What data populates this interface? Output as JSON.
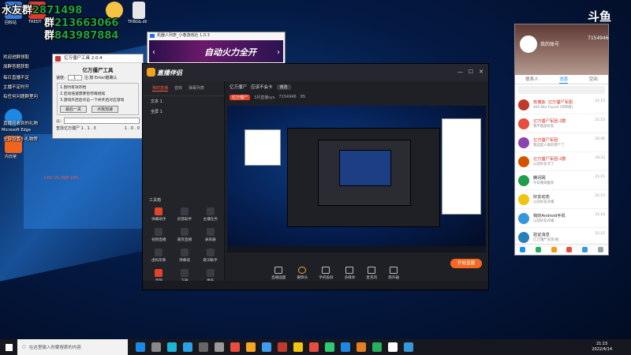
{
  "overlay": {
    "line1": "水友群",
    "line1_num": "2871498",
    "line2_prefix": "群",
    "line2_num": "213663066",
    "line3_prefix": "群",
    "line3_num": "843987884",
    "notes": [
      "欢迎进群领取",
      "加群答题获取",
      "每日直播不定",
      "主播不定时开",
      "有任何问题群里问",
      "直播间收到的礼物",
      "全部设置小礼物赞"
    ]
  },
  "desktop": {
    "icons": [
      {
        "label": "回收站",
        "color": "#3a7bd5"
      },
      {
        "label": "TREDT",
        "color": "#e23b2a"
      },
      {
        "label": "QQ",
        "color": "#f6c343"
      },
      {
        "label": "TRBGb.dll",
        "color": "#e6e6e6"
      },
      {
        "label": "Microsoft Edge",
        "color": "#1e88e5"
      },
      {
        "label": "内日常",
        "color": "#f0641e"
      }
    ],
    "cpu_text": "CPU 1%  内存 19%"
  },
  "tool_window": {
    "title": "亿万僵尸工具 2.0.4",
    "header": "亿万僵尸工具",
    "speed_label": "速度:",
    "speed_value": "1",
    "speed_hint": "注:按 Enter键确认",
    "steps": [
      "1.暂时有效存档",
      "2.启动倍速需要暂停再继续",
      "3.游戏开启后点击一下并开启对应游戏"
    ],
    "btn_prev": "最后一关",
    "btn_apply": "点我加速",
    "save_label": "以:",
    "footer_left": "查找亿万僵尸 1 . 1 . 3",
    "footer_right": "1 . 0 . 0"
  },
  "ad_window": {
    "title": "机器人列表_小巷游戏社 1.0.3",
    "banner_text": "自动火力全开"
  },
  "app": {
    "logo": "直播伴侣",
    "side_tabs": [
      "我的直播",
      "音效",
      "弹幕列表"
    ],
    "scenes": [
      "文本 1",
      "全屏 1"
    ],
    "tools_title": "工具箱",
    "tools": [
      {
        "label": "弹幕助手",
        "active": true
      },
      {
        "label": "房管助手",
        "active": false
      },
      {
        "label": "主播任务",
        "active": false
      },
      {
        "label": "视频直播",
        "active": false
      },
      {
        "label": "嘉宾直播",
        "active": false
      },
      {
        "label": "录屏器",
        "active": false
      },
      {
        "label": "虚拟形象",
        "active": false
      },
      {
        "label": "弹幕墙",
        "active": false
      },
      {
        "label": "歌词助手",
        "active": false
      },
      {
        "label": "音频",
        "active": false
      },
      {
        "label": "下载",
        "active": false
      },
      {
        "label": "更多",
        "active": false
      }
    ],
    "title_game": "亿万僵尸",
    "title_hint": "应该不会卡",
    "title_badge": "修改",
    "tag": "亿万僵尸",
    "room_id": "7154946",
    "streamer": "3月直播sys",
    "viewers": "95",
    "controls": [
      "直播画面",
      "摄像头",
      "手机投屏",
      "多媒体",
      "麦克风",
      "扬声器"
    ],
    "go_live": "开始直播",
    "status": "斗鱼直播助手正在运行中"
  },
  "panel": {
    "name": "我的账号",
    "tabs": [
      "联系人",
      "消息",
      "空间"
    ],
    "messages": [
      {
        "name": "玫瑰金. 亿万僵尸军团",
        "sub": "404 Not Found (待审核)",
        "time": "21:15",
        "red": true,
        "color": "#c0392b"
      },
      {
        "name": "亿万僵尸军团-2群",
        "sub": "我不能加好友",
        "time": "21:15",
        "red": true,
        "color": "#e74c3c"
      },
      {
        "name": "亿万僵尸军团",
        "sub": "我还是人家的那个了",
        "time": "20:46",
        "red": true,
        "color": "#8e44ad"
      },
      {
        "name": "亿万僵尸军团-2群",
        "sub": "以前好多次了",
        "time": "19:33",
        "red": true,
        "color": "#d35400"
      },
      {
        "name": "腾讯网",
        "sub": "今日要闻推荐",
        "time": "21:15",
        "red": false,
        "color": "#1e9e4a"
      },
      {
        "name": "好友动态",
        "sub": "以前好友开播",
        "time": "21:15",
        "red": false,
        "color": "#f1c40f"
      },
      {
        "name": "我的Android手机",
        "sub": "以前好友开播",
        "time": "21:14",
        "red": false,
        "color": "#3498db"
      },
      {
        "name": "验证消息",
        "sub": "亿万僵尸军团-群",
        "time": "21:15",
        "red": false,
        "color": "#2980b9"
      }
    ],
    "brand": "斗鱼",
    "room_text": "7154946"
  },
  "taskbar": {
    "search_placeholder": "在这里输入你要搜索的内容",
    "time": "21:15",
    "date": "2022/4/14",
    "icons": [
      "#1e88e5",
      "#888",
      "#1db4d8",
      "#2aa0e8",
      "#666",
      "#999",
      "#e94b3c",
      "#f5a623",
      "#3d9df0",
      "#c0392b",
      "#f1c40f",
      "#e74c3c",
      "#2ecc71",
      "#1e88e5",
      "#e67e22",
      "#27ae60",
      "#fff",
      "#3498db"
    ]
  }
}
